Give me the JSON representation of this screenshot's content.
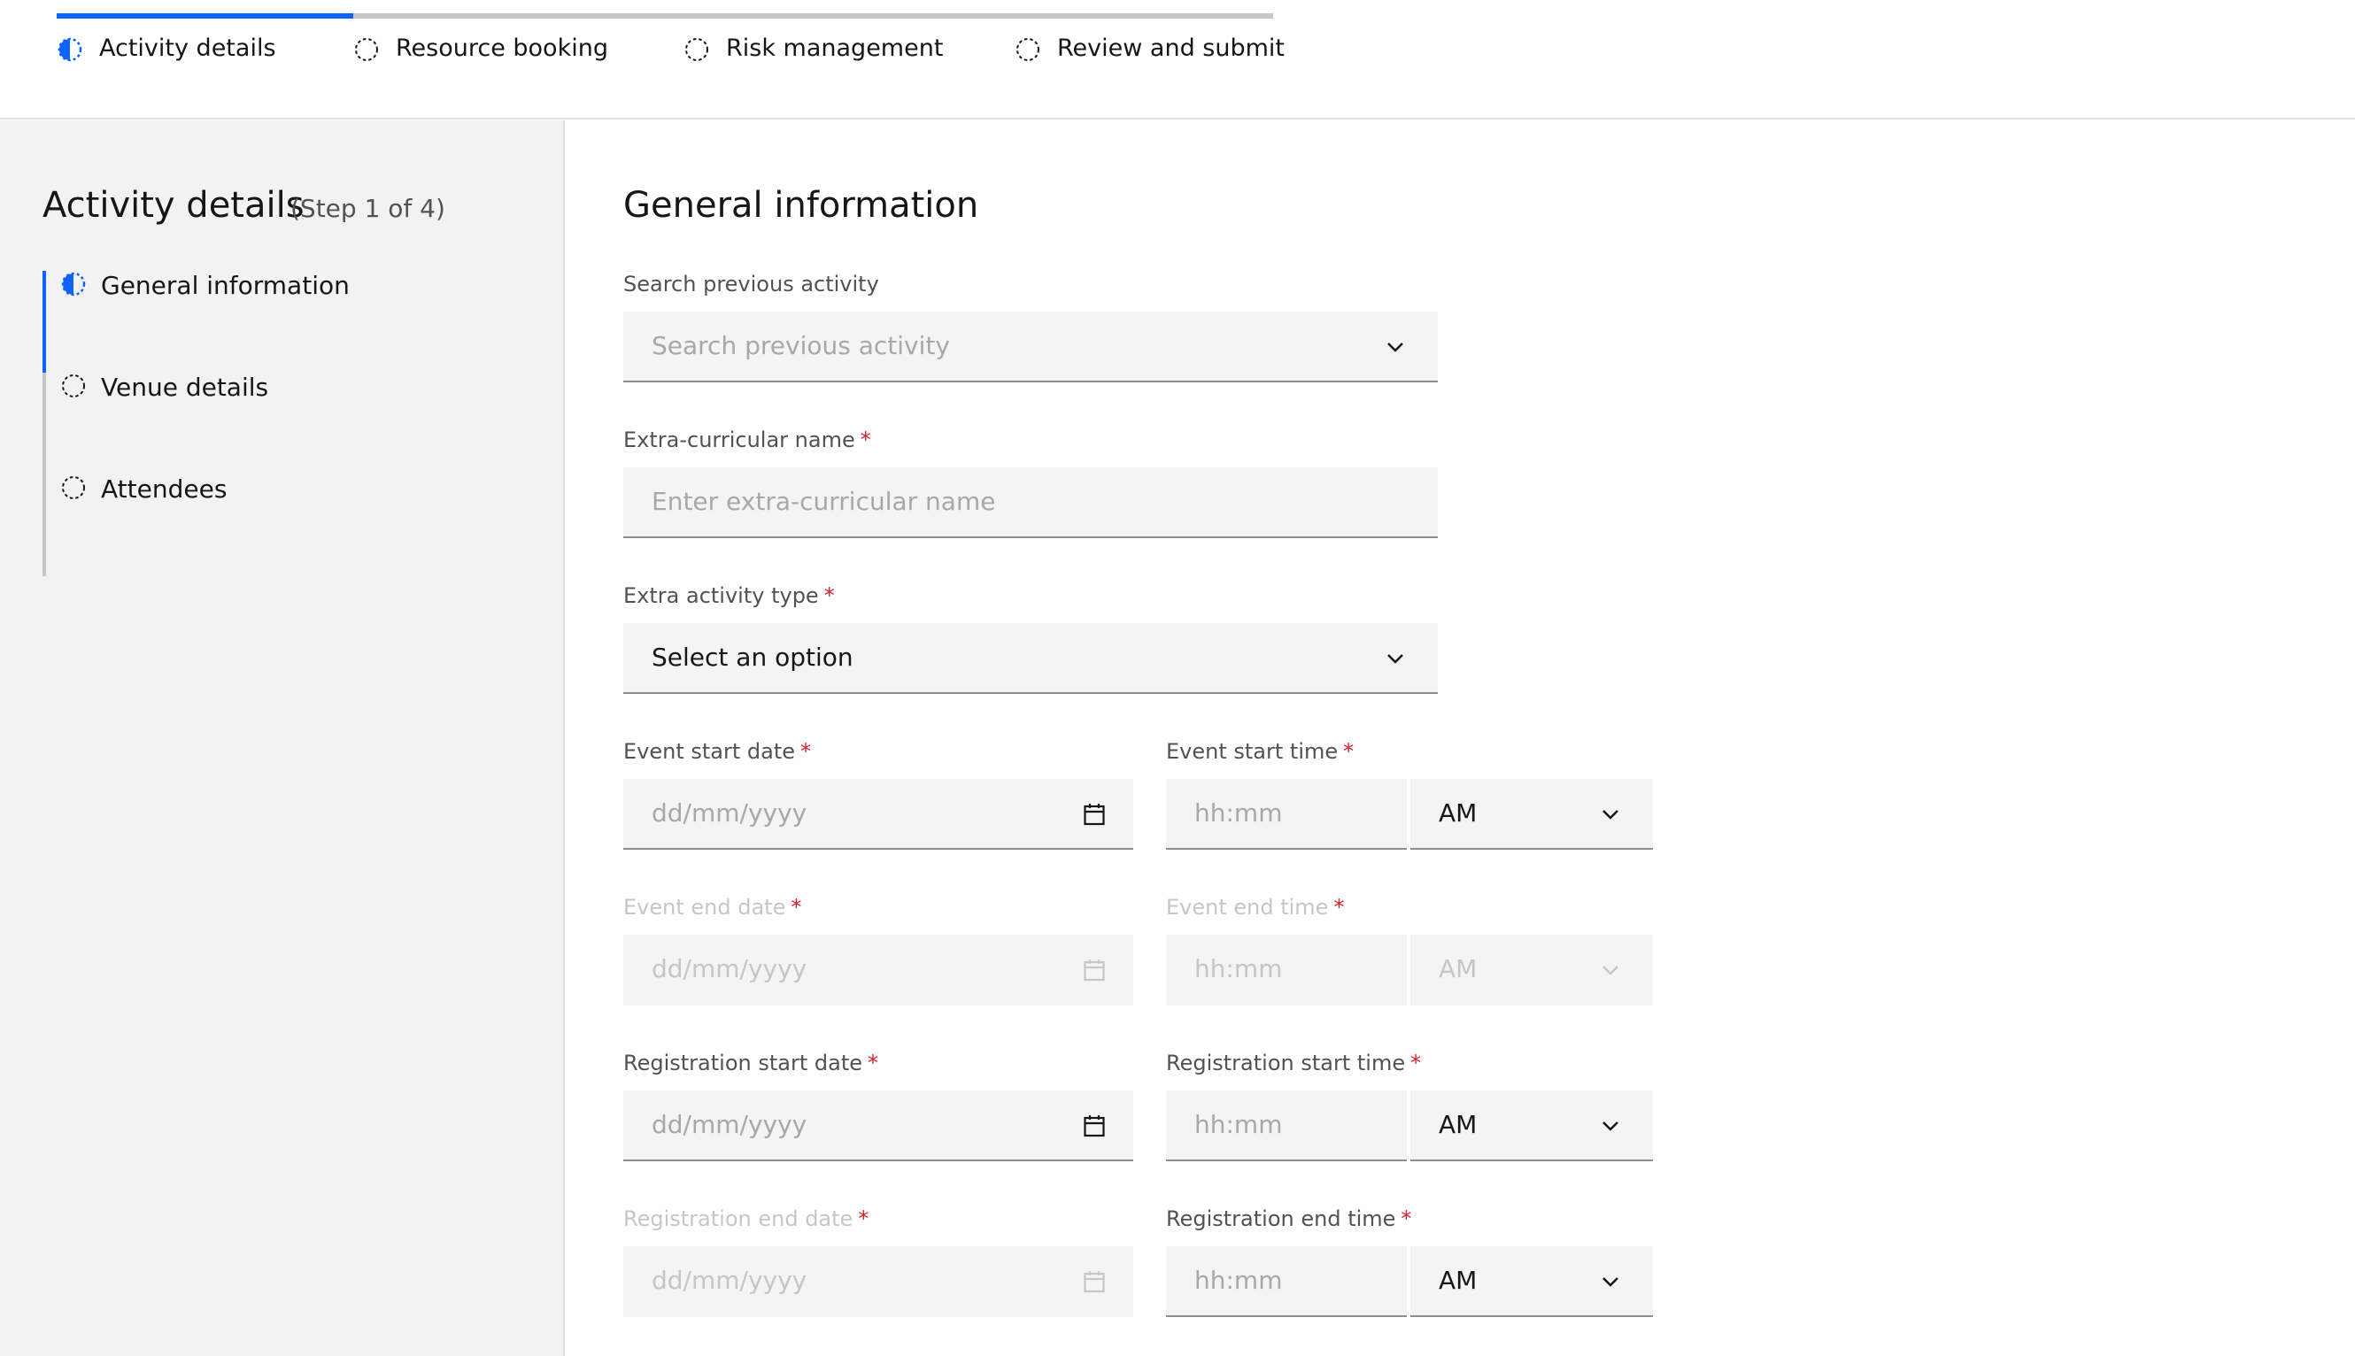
{
  "progress": {
    "steps": [
      {
        "label": "Activity details",
        "state": "current",
        "icon": "half-filled-circle-icon"
      },
      {
        "label": "Resource booking",
        "state": "incomplete",
        "icon": "dashed-circle-icon"
      },
      {
        "label": "Risk management",
        "state": "incomplete",
        "icon": "dashed-circle-icon"
      },
      {
        "label": "Review and submit",
        "state": "incomplete",
        "icon": "dashed-circle-icon"
      }
    ]
  },
  "sidebar": {
    "title": "Activity details",
    "step_count": "(Step 1 of 4)",
    "substeps": [
      {
        "label": "General information",
        "state": "current"
      },
      {
        "label": "Venue details",
        "state": "incomplete"
      },
      {
        "label": "Attendees",
        "state": "incomplete"
      }
    ]
  },
  "form": {
    "title": "General information",
    "required_marker": "*",
    "search_activity": {
      "label": "Search previous activity",
      "placeholder": "Search previous activity"
    },
    "curricular_name": {
      "label": "Extra-curricular name",
      "placeholder": "Enter extra-curricular name"
    },
    "activity_type": {
      "label": "Extra activity type",
      "value": "Select an option"
    },
    "event_start_date": {
      "label": "Event start date",
      "placeholder": "dd/mm/yyyy"
    },
    "event_start_time": {
      "label": "Event start time",
      "placeholder": "hh:mm",
      "period": "AM"
    },
    "event_end_date": {
      "label": "Event end date",
      "placeholder": "dd/mm/yyyy",
      "disabled": true
    },
    "event_end_time": {
      "label": "Event end time",
      "placeholder": "hh:mm",
      "period": "AM",
      "disabled": true
    },
    "reg_start_date": {
      "label": "Registration start date",
      "placeholder": "dd/mm/yyyy"
    },
    "reg_start_time": {
      "label": "Registration start time",
      "placeholder": "hh:mm",
      "period": "AM"
    },
    "reg_end_date": {
      "label": "Registration end date",
      "placeholder": "dd/mm/yyyy",
      "disabled": true
    },
    "reg_end_time": {
      "label": "Registration end time",
      "placeholder": "hh:mm",
      "period": "AM"
    }
  },
  "colors": {
    "accent": "#0f62fe",
    "required": "#da1e28",
    "field_bg": "#f4f4f4",
    "sidebar_bg": "#f2f2f2"
  }
}
